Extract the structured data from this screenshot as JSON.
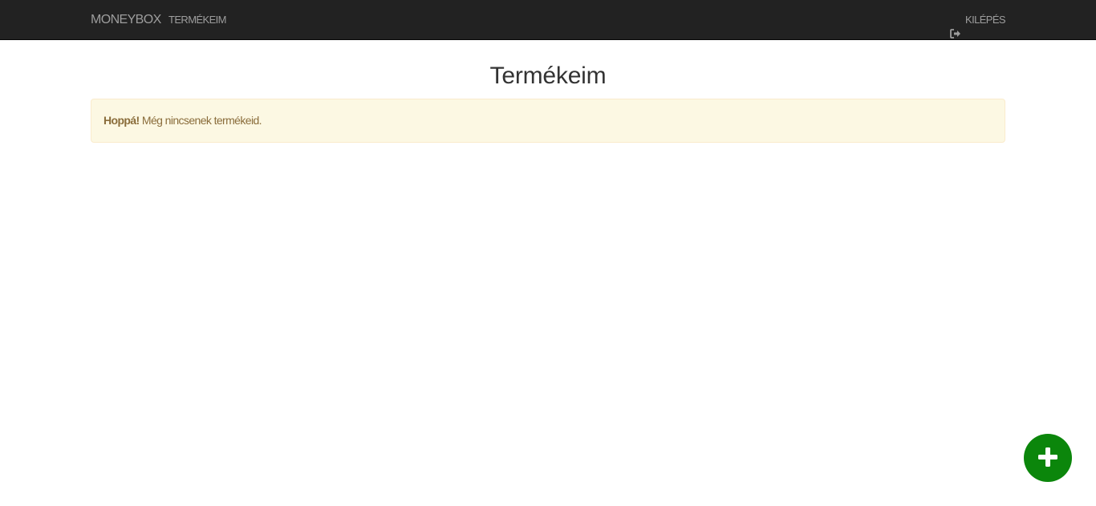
{
  "navbar": {
    "brand": "MONEYBOX",
    "nav_item": "TERMÉKEIM",
    "logout_label": "KILÉPÉS",
    "logout_icon": "sign-out-icon"
  },
  "main": {
    "title": "Termékeim",
    "alert": {
      "strong": "Hoppá!",
      "message": " Még nincsenek termékeid."
    }
  },
  "fab": {
    "icon": "plus-icon",
    "color": "#0b860b"
  },
  "colors": {
    "navbar_bg": "#222222",
    "nav_text": "#9d9d9d",
    "alert_bg": "#fcf8e3",
    "alert_text": "#8a6d3b"
  }
}
